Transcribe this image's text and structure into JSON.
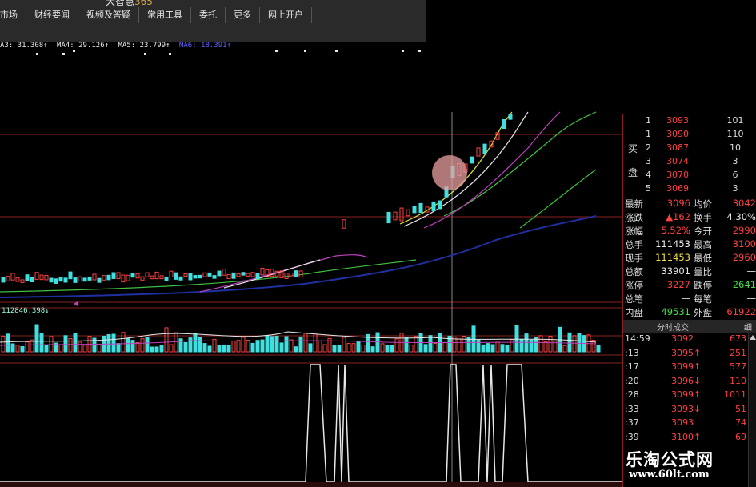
{
  "brand": {
    "name": "大智慧",
    "suffix": "365"
  },
  "menu": {
    "items": [
      "市场",
      "财经要闻",
      "视频及答疑",
      "常用工具",
      "委托",
      "更多",
      "网上开户"
    ]
  },
  "ma_line": {
    "items": [
      {
        "text": "A3: 31.308↑",
        "color": "#e8e8e8"
      },
      {
        "text": "MA4: 29.126↑",
        "color": "#e8e8e8"
      },
      {
        "text": "MA5: 23.799↑",
        "color": "#e8e8e8"
      },
      {
        "text": "MA6: 18.391↑",
        "color": "#6060ff"
      }
    ]
  },
  "volume_label": "112846.398↓",
  "order_book": {
    "buy_label_top": "买",
    "buy_label_bottom": "盘",
    "rows": [
      {
        "idx": "1",
        "price": "3093",
        "vol": "101"
      },
      {
        "idx": "1",
        "price": "3090",
        "vol": "110"
      },
      {
        "idx": "2",
        "price": "3087",
        "vol": "10"
      },
      {
        "idx": "3",
        "price": "3074",
        "vol": "3"
      },
      {
        "idx": "4",
        "price": "3070",
        "vol": "6"
      },
      {
        "idx": "5",
        "price": "3069",
        "vol": "3"
      }
    ]
  },
  "stats": [
    {
      "l1": "最新",
      "v1": "3096",
      "c1": "red",
      "l2": "均价",
      "v2": "3042",
      "c2": "red"
    },
    {
      "l1": "涨跌",
      "v1": "▲162",
      "c1": "red",
      "l2": "换手",
      "v2": "4.30%",
      "c2": "white"
    },
    {
      "l1": "涨幅",
      "v1": "5.52%",
      "c1": "red",
      "l2": "今开",
      "v2": "2990",
      "c2": "red"
    },
    {
      "l1": "总手",
      "v1": "111453",
      "c1": "white",
      "l2": "最高",
      "v2": "3100",
      "c2": "red"
    },
    {
      "l1": "现手",
      "v1": "111453",
      "c1": "yellow",
      "l2": "最低",
      "v2": "2960",
      "c2": "red"
    },
    {
      "l1": "总额",
      "v1": "33901",
      "c1": "white",
      "l2": "量比",
      "v2": "—",
      "c2": "white"
    },
    {
      "l1": "涨停",
      "v1": "3227",
      "c1": "red",
      "l2": "跌停",
      "v2": "2641",
      "c2": "green"
    },
    {
      "l1": "总笔",
      "v1": "—",
      "c1": "white",
      "l2": "每笔",
      "v2": "—",
      "c2": "white"
    },
    {
      "l1": "内盘",
      "v1": "49531",
      "c1": "green",
      "l2": "外盘",
      "v2": "61922",
      "c2": "red"
    }
  ],
  "tabs": {
    "trades_tab": "分时成交",
    "extra_tab": "细"
  },
  "ticks": [
    {
      "time": "14:59",
      "price": "3092",
      "vol": "673"
    },
    {
      "time": ":13",
      "price": "3095↑",
      "vol": "251"
    },
    {
      "time": ":17",
      "price": "3099↑",
      "vol": "577"
    },
    {
      "time": ":20",
      "price": "3096↓",
      "vol": "110"
    },
    {
      "time": ":28",
      "price": "3099↑",
      "vol": "1011"
    },
    {
      "time": ":33",
      "price": "3093↓",
      "vol": "51"
    },
    {
      "time": ":37",
      "price": "3093",
      "vol": "74"
    },
    {
      "time": ":39",
      "price": "3100↑",
      "vol": "69"
    }
  ],
  "watermark": {
    "line1": "乐淘公式网",
    "line2": "www.60lt.com"
  },
  "colors": {
    "up": "#ff4040",
    "down": "#40e0e0",
    "grid": "#8a2020",
    "ma_white": "#e8e8e8",
    "ma_yellow": "#e0e040",
    "ma_purple": "#c040c0",
    "ma_green": "#40c040",
    "ma_blue": "#2030a0"
  }
}
